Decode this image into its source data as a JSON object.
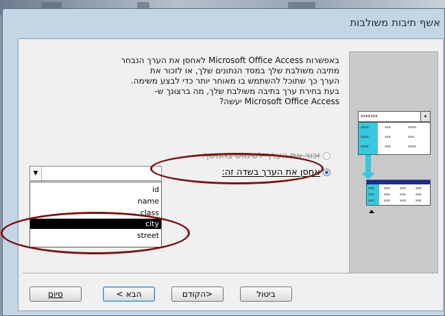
{
  "window": {
    "title": "אשף תיבות משולבות"
  },
  "description": {
    "lines": [
      "באפשרות Microsoft Office Access לאחסן את הערך הנבחר",
      "מתיבה משולבת שלך במסד הנתונים שלך, או לזכור את",
      "הערך כך שתוכל להשתמש בו מאוחר יותר כדי לבצע משימה.",
      "בעת בחירת ערך בתיבה משולבת שלך, מה ברצונך ש-",
      "Microsoft Office Access יעשה?"
    ]
  },
  "preview": {
    "combo_text": "xxxxxxx",
    "grid_cells": [
      "xxxx",
      "xxx",
      "xxxx",
      "xxxx",
      "xxx",
      "xxx",
      "xxxx",
      "xxx",
      "xxxx"
    ],
    "table_cells": [
      "xxx",
      "xxx",
      "xxx",
      "xxx",
      "xxx",
      "xxx",
      "xxx",
      "xxx",
      "xxx",
      "xxx",
      "xxx",
      "xxx"
    ]
  },
  "options": {
    "remember_label": "זכור את הערך לשימוש בהמשך.",
    "store_label": "אחסן את הערך בשדה זה:",
    "selected": "store"
  },
  "field_select": {
    "value": "",
    "options": [
      "id",
      "name",
      "class",
      "city",
      "street"
    ],
    "highlighted": "city"
  },
  "buttons": {
    "cancel": "ביטול",
    "back": "<הקודם",
    "next": "הבא >",
    "finish": "סיום"
  },
  "colors": {
    "annotation": "#7a1010",
    "highlight": "#38c8e0",
    "selection": "#000000"
  }
}
